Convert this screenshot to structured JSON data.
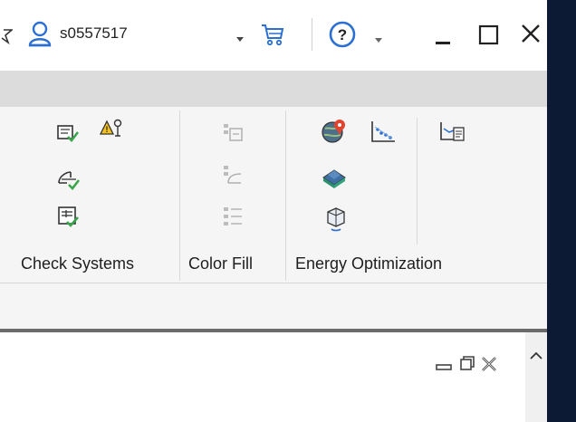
{
  "titlebar": {
    "username": "s0557517",
    "icons": [
      "star-icon",
      "user-icon",
      "dropdown-caret-icon",
      "cart-icon",
      "help-icon",
      "help-dropdown-icon",
      "minimize-icon",
      "maximize-icon",
      "close-icon"
    ]
  },
  "ribbon": {
    "panels": [
      {
        "label": "Check Systems"
      },
      {
        "label": "Color Fill"
      },
      {
        "label": "Energy Optimization"
      }
    ]
  },
  "view_controls": {
    "icons": [
      "view-minimize-icon",
      "view-restore-icon",
      "view-close-icon",
      "scroll-up-icon"
    ]
  }
}
